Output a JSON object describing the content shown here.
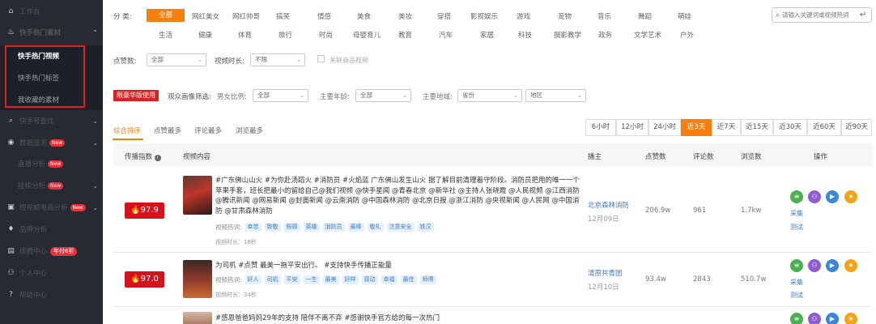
{
  "sidebar": {
    "items": [
      {
        "icon": "home-icon",
        "glyph": "⌂",
        "label": "工作台"
      },
      {
        "icon": "fire-icon",
        "glyph": "♨",
        "label": "快手热门素材"
      },
      {
        "icon": "search-icon",
        "glyph": "⌕",
        "label": "快手号查找"
      },
      {
        "icon": "monitor-icon",
        "glyph": "◉",
        "label": "数据监测",
        "badge": "New"
      },
      {
        "icon": "live-icon",
        "glyph": "",
        "label": "直播分析",
        "badge": "New"
      },
      {
        "icon": "rank-icon",
        "glyph": "",
        "label": "挂榜分析",
        "badge": "New"
      },
      {
        "icon": "cart-icon",
        "glyph": "▣",
        "label": "短视频电商分析",
        "badge": "New"
      },
      {
        "icon": "diamond-icon",
        "glyph": "♦",
        "label": "品牌分析"
      },
      {
        "icon": "vip-icon",
        "glyph": "▤",
        "label": "续费中心",
        "badge": "年付6折"
      },
      {
        "icon": "user-icon",
        "glyph": "⚇",
        "label": "个人中心"
      },
      {
        "icon": "help-icon",
        "glyph": "?",
        "label": "帮助中心"
      }
    ],
    "subitems": [
      "快手热门视频",
      "快手热门标签",
      "我收藏的素材"
    ]
  },
  "filters": {
    "category_label": "分 类:",
    "categories_row1": [
      "全部",
      "网红美女",
      "网红帅哥",
      "搞笑",
      "情感",
      "美食",
      "美妆",
      "穿搭",
      "影视娱乐",
      "游戏",
      "宠物",
      "音乐",
      "舞蹈",
      "萌娃"
    ],
    "categories_row2": [
      "生活",
      "健康",
      "体育",
      "旅行",
      "时尚",
      "母婴育儿",
      "教育",
      "汽车",
      "家居",
      "科技",
      "摄影教学",
      "政务",
      "文学艺术",
      "户外"
    ],
    "search_placeholder": "请输入关键词或视频热词",
    "likes_label": "点赞数:",
    "likes_value": "全部",
    "duration_label": "视频时长:",
    "duration_value": "不限",
    "related_label": "关联商品视频",
    "limited_tag": "限豪华版使用",
    "audience_label": "观众画像筛选:",
    "gender_label": "男女比例:",
    "gender_value": "全部",
    "age_label": "主要年龄:",
    "age_value": "全部",
    "region_label": "主要地域:",
    "region_value": "省份",
    "city_value": "地区"
  },
  "tabs": [
    "综合排序",
    "点赞最多",
    "评论最多",
    "浏览最多"
  ],
  "time_ranges": [
    "6小时",
    "12小时",
    "24小时",
    "近3天",
    "近7天",
    "近15天",
    "近30天",
    "近60天",
    "近90天"
  ],
  "table": {
    "headers": [
      "传播指数",
      "视频内容",
      "播主",
      "点赞数",
      "评论数",
      "浏览数",
      "操作"
    ],
    "hot_label": "视频热词:",
    "rows": [
      {
        "score": "97.9",
        "title": "#广东佛山山火 #为你赴汤蹈火 #消防员 #火焰蓝 广东佛山发生山火 据了解目前清理着守阶段。消防员把用的唯一一个苹果手套，班长把最小的留给自己@我们视频 @快手星闻 @青春北京 @新华社 @主持人张晓霞 @人民视频 @江西消防 @腾讯新闻 @网易新闻 @封面新闻 @云南消防 @中国森林消防 @北京日报 @浙江消防 @央视新闻 @人民网 @中国消防 @甘肃森林消防",
        "tags": [
          "幸苦",
          "致敬",
          "照顾",
          "英雄",
          "消防员",
          "最棒",
          "敬礼",
          "注意安全",
          "铁汉"
        ],
        "duration": "视频时长：18秒",
        "anchor": "北京森林消防",
        "date": "12月09日",
        "likes": "206.9w",
        "comments": "961",
        "views": "1.7kw"
      },
      {
        "score": "97.0",
        "title": "为司机 #点赞 最美一拖平安出行。 #支持快手传播正能量",
        "tags": [
          "好人",
          "司机",
          "平安",
          "一生",
          "最美",
          "好样",
          "感动",
          "幸福",
          "最佳",
          "师傅"
        ],
        "duration": "视频时长：34秒",
        "anchor": "清原共青团",
        "date": "12月10日",
        "likes": "93.4w",
        "comments": "2843",
        "views": "510.7w"
      },
      {
        "title": "#感恩爸爸妈妈29年的支持 陪伴不离不弃 #感谢快手官方给的每一次热门"
      }
    ],
    "op_collect": "采集",
    "op_test": "测试"
  },
  "colors": {
    "accent": "#f77f0f",
    "sidebar": "#262a33",
    "score": "#d7111c",
    "link": "#3a7bd5"
  }
}
